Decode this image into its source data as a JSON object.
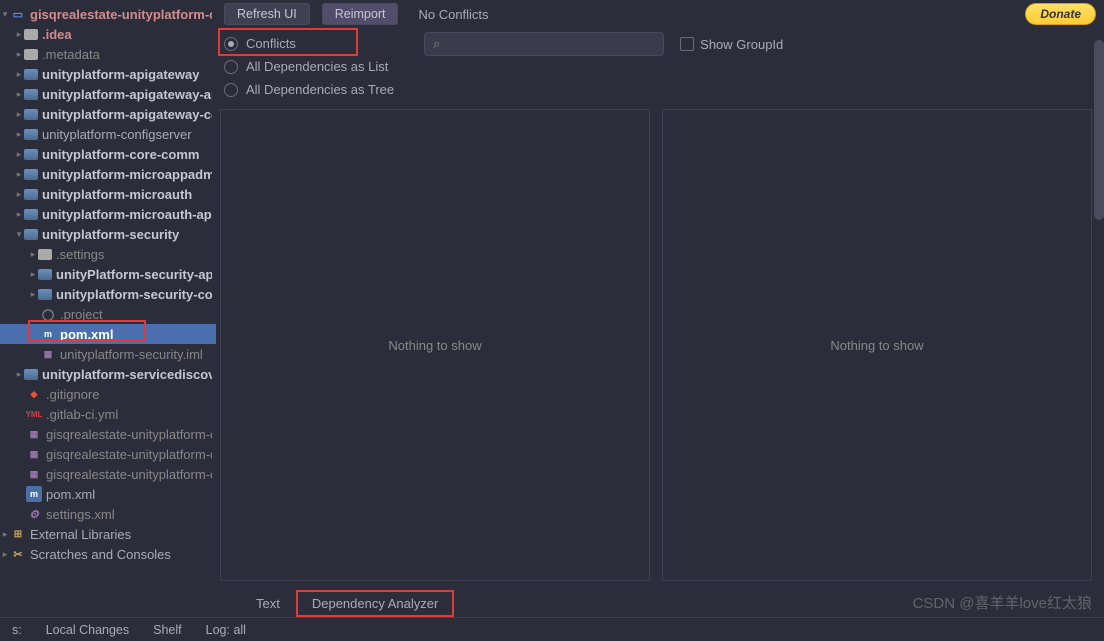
{
  "toolbar": {
    "refresh": "Refresh UI",
    "reimport": "Reimport",
    "noConflicts": "No Conflicts",
    "donate": "Donate"
  },
  "options": {
    "conflicts": "Conflicts",
    "depList": "All Dependencies as List",
    "depTree": "All Dependencies as Tree",
    "searchIcon": "⌕",
    "showGroupId": "Show GroupId"
  },
  "panels": {
    "nothing": "Nothing to show"
  },
  "bottomTabs": {
    "text": "Text",
    "depAnalyzer": "Dependency Analyzer"
  },
  "statusBar": {
    "vcs": "s:",
    "localChanges": "Local Changes",
    "shelf": "Shelf",
    "log": "Log: all"
  },
  "watermark": "CSDN @喜羊羊love红太狼",
  "tree": {
    "root": "gisqrealestate-unityplatform-co",
    "idea": ".idea",
    "metadata": ".metadata",
    "apigateway": "unityplatform-apigateway",
    "apigatewayAp": "unityplatform-apigateway-ap",
    "apigatewayCo": "unityplatform-apigateway-co",
    "configserver": "unityplatform-configserver",
    "coreComm": "unityplatform-core-comm",
    "microappadm": "unityplatform-microappadm",
    "microauth": "unityplatform-microauth",
    "microauthAp": "unityplatform-microauth-ap",
    "security": "unityplatform-security",
    "settings": ".settings",
    "securityAp": "unityPlatform-security-ap",
    "securityCo": "unityplatform-security-co",
    "project": ".project",
    "pom": "pom.xml",
    "securityIml": "unityplatform-security.iml",
    "servicediscove": "unityplatform-servicediscove",
    "gitignore": ".gitignore",
    "gitlabCi": ".gitlab-ci.yml",
    "gisq1": "gisqrealestate-unityplatform-c",
    "gisq2": "gisqrealestate-unityplatform-c",
    "gisq3": "gisqrealestate-unityplatform-c",
    "rootPom": "pom.xml",
    "settingsXml": "settings.xml",
    "extLib": "External Libraries",
    "scratches": "Scratches and Consoles"
  }
}
